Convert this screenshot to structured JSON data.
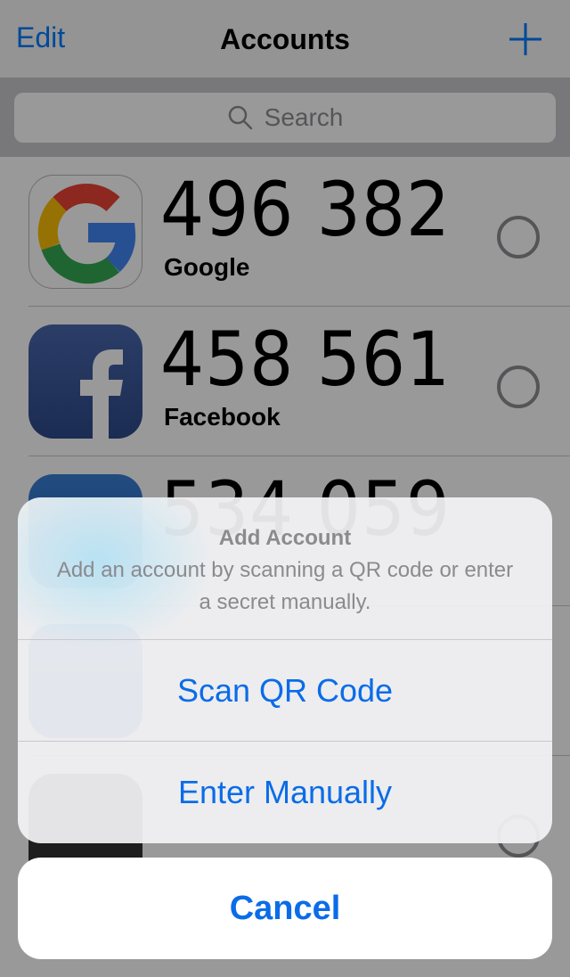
{
  "navbar": {
    "edit_label": "Edit",
    "title": "Accounts",
    "add_icon": "plus-icon"
  },
  "search": {
    "placeholder": "Search",
    "icon": "search-icon"
  },
  "accounts": [
    {
      "code": "496 382",
      "name": "Google",
      "icon": "google-icon"
    },
    {
      "code": "458 561",
      "name": "Facebook",
      "icon": "facebook-icon"
    },
    {
      "code": "534 059",
      "name": "",
      "icon": "app-icon"
    },
    {
      "code": "",
      "name": "",
      "icon": "app-icon"
    },
    {
      "code": "",
      "name": "",
      "icon": "github-icon"
    }
  ],
  "action_sheet": {
    "title": "Add Account",
    "message": "Add an account by scanning a QR code or enter a secret manually.",
    "actions": [
      {
        "label": "Scan QR Code"
      },
      {
        "label": "Enter Manually"
      }
    ],
    "cancel_label": "Cancel"
  },
  "colors": {
    "accent": "#0a6ce8",
    "navbar_bg": "#f7f7f7",
    "search_bar_bg": "#c9c9ce",
    "overlay": "rgba(0,0,0,0.40)"
  }
}
